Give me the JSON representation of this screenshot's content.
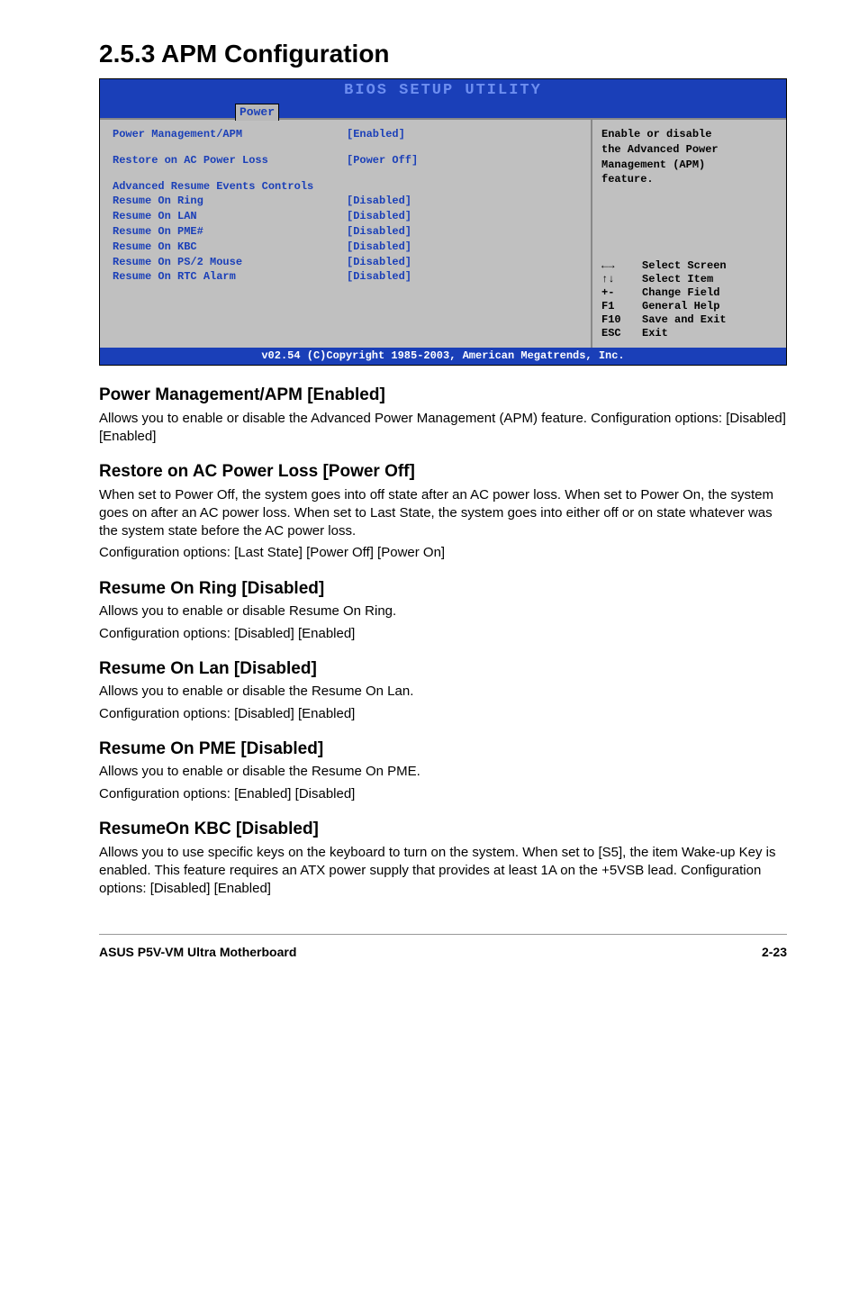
{
  "section_title": "2.5.3   APM Configuration",
  "bios": {
    "top_title": "BIOS SETUP UTILITY",
    "tab": "Power",
    "left": {
      "rows_top": [
        {
          "label": "Power Management/APM",
          "value": "[Enabled]"
        },
        {
          "label": "Restore on AC Power Loss",
          "value": "[Power Off]"
        }
      ],
      "subhead": "Advanced Resume Events Controls",
      "rows_bottom": [
        {
          "label": "Resume On Ring",
          "value": "[Disabled]"
        },
        {
          "label": "Resume On LAN",
          "value": "[Disabled]"
        },
        {
          "label": "Resume On PME#",
          "value": "[Disabled]"
        },
        {
          "label": "Resume On KBC",
          "value": "[Disabled]"
        },
        {
          "label": "Resume On PS/2 Mouse",
          "value": "[Disabled]"
        },
        {
          "label": "Resume On RTC Alarm",
          "value": "[Disabled]"
        }
      ]
    },
    "right": {
      "desc1": "Enable or disable",
      "desc2": "the Advanced Power",
      "desc3": "Management (APM)",
      "desc4": "feature.",
      "help": [
        {
          "key": "←→",
          "text": "Select Screen"
        },
        {
          "key": "↑↓",
          "text": "Select Item"
        },
        {
          "key": "+-",
          "text": "Change Field"
        },
        {
          "key": "F1",
          "text": "General Help"
        },
        {
          "key": "F10",
          "text": "Save and Exit"
        },
        {
          "key": "ESC",
          "text": "Exit"
        }
      ]
    },
    "footer": "v02.54 (C)Copyright 1985-2003, American Megatrends, Inc."
  },
  "sections": [
    {
      "heading": "Power Management/APM [Enabled]",
      "paragraphs": [
        "Allows you to enable or disable the Advanced Power Management (APM) feature. Configuration options: [Disabled] [Enabled]"
      ]
    },
    {
      "heading": "Restore on AC Power Loss [Power Off]",
      "paragraphs": [
        "When set to Power Off, the system goes into off state after an AC power loss. When set to Power On, the system goes on after an AC power loss. When set to Last State, the system goes into either off or on state whatever was the system state before the AC power loss.",
        "Configuration options: [Last State] [Power Off] [Power On]"
      ]
    },
    {
      "heading": "Resume On Ring [Disabled]",
      "paragraphs": [
        "Allows you to enable or disable Resume On Ring.",
        "Configuration options: [Disabled] [Enabled]"
      ]
    },
    {
      "heading": "Resume On Lan [Disabled]",
      "paragraphs": [
        "Allows you to enable or disable the Resume On Lan.",
        "Configuration options: [Disabled] [Enabled]"
      ]
    },
    {
      "heading": "Resume On PME [Disabled]",
      "paragraphs": [
        "Allows you to enable or disable the Resume On PME.",
        "Configuration options: [Enabled] [Disabled]"
      ]
    },
    {
      "heading": "ResumeOn KBC [Disabled]",
      "paragraphs": [
        "Allows you to use specific keys on the keyboard to turn on the system. When set to [S5], the item Wake-up Key is enabled. This feature requires an ATX power supply that provides at least 1A on the +5VSB lead. Configuration options: [Disabled] [Enabled]"
      ]
    }
  ],
  "footer": {
    "left": "ASUS P5V-VM Ultra Motherboard",
    "right": "2-23"
  }
}
